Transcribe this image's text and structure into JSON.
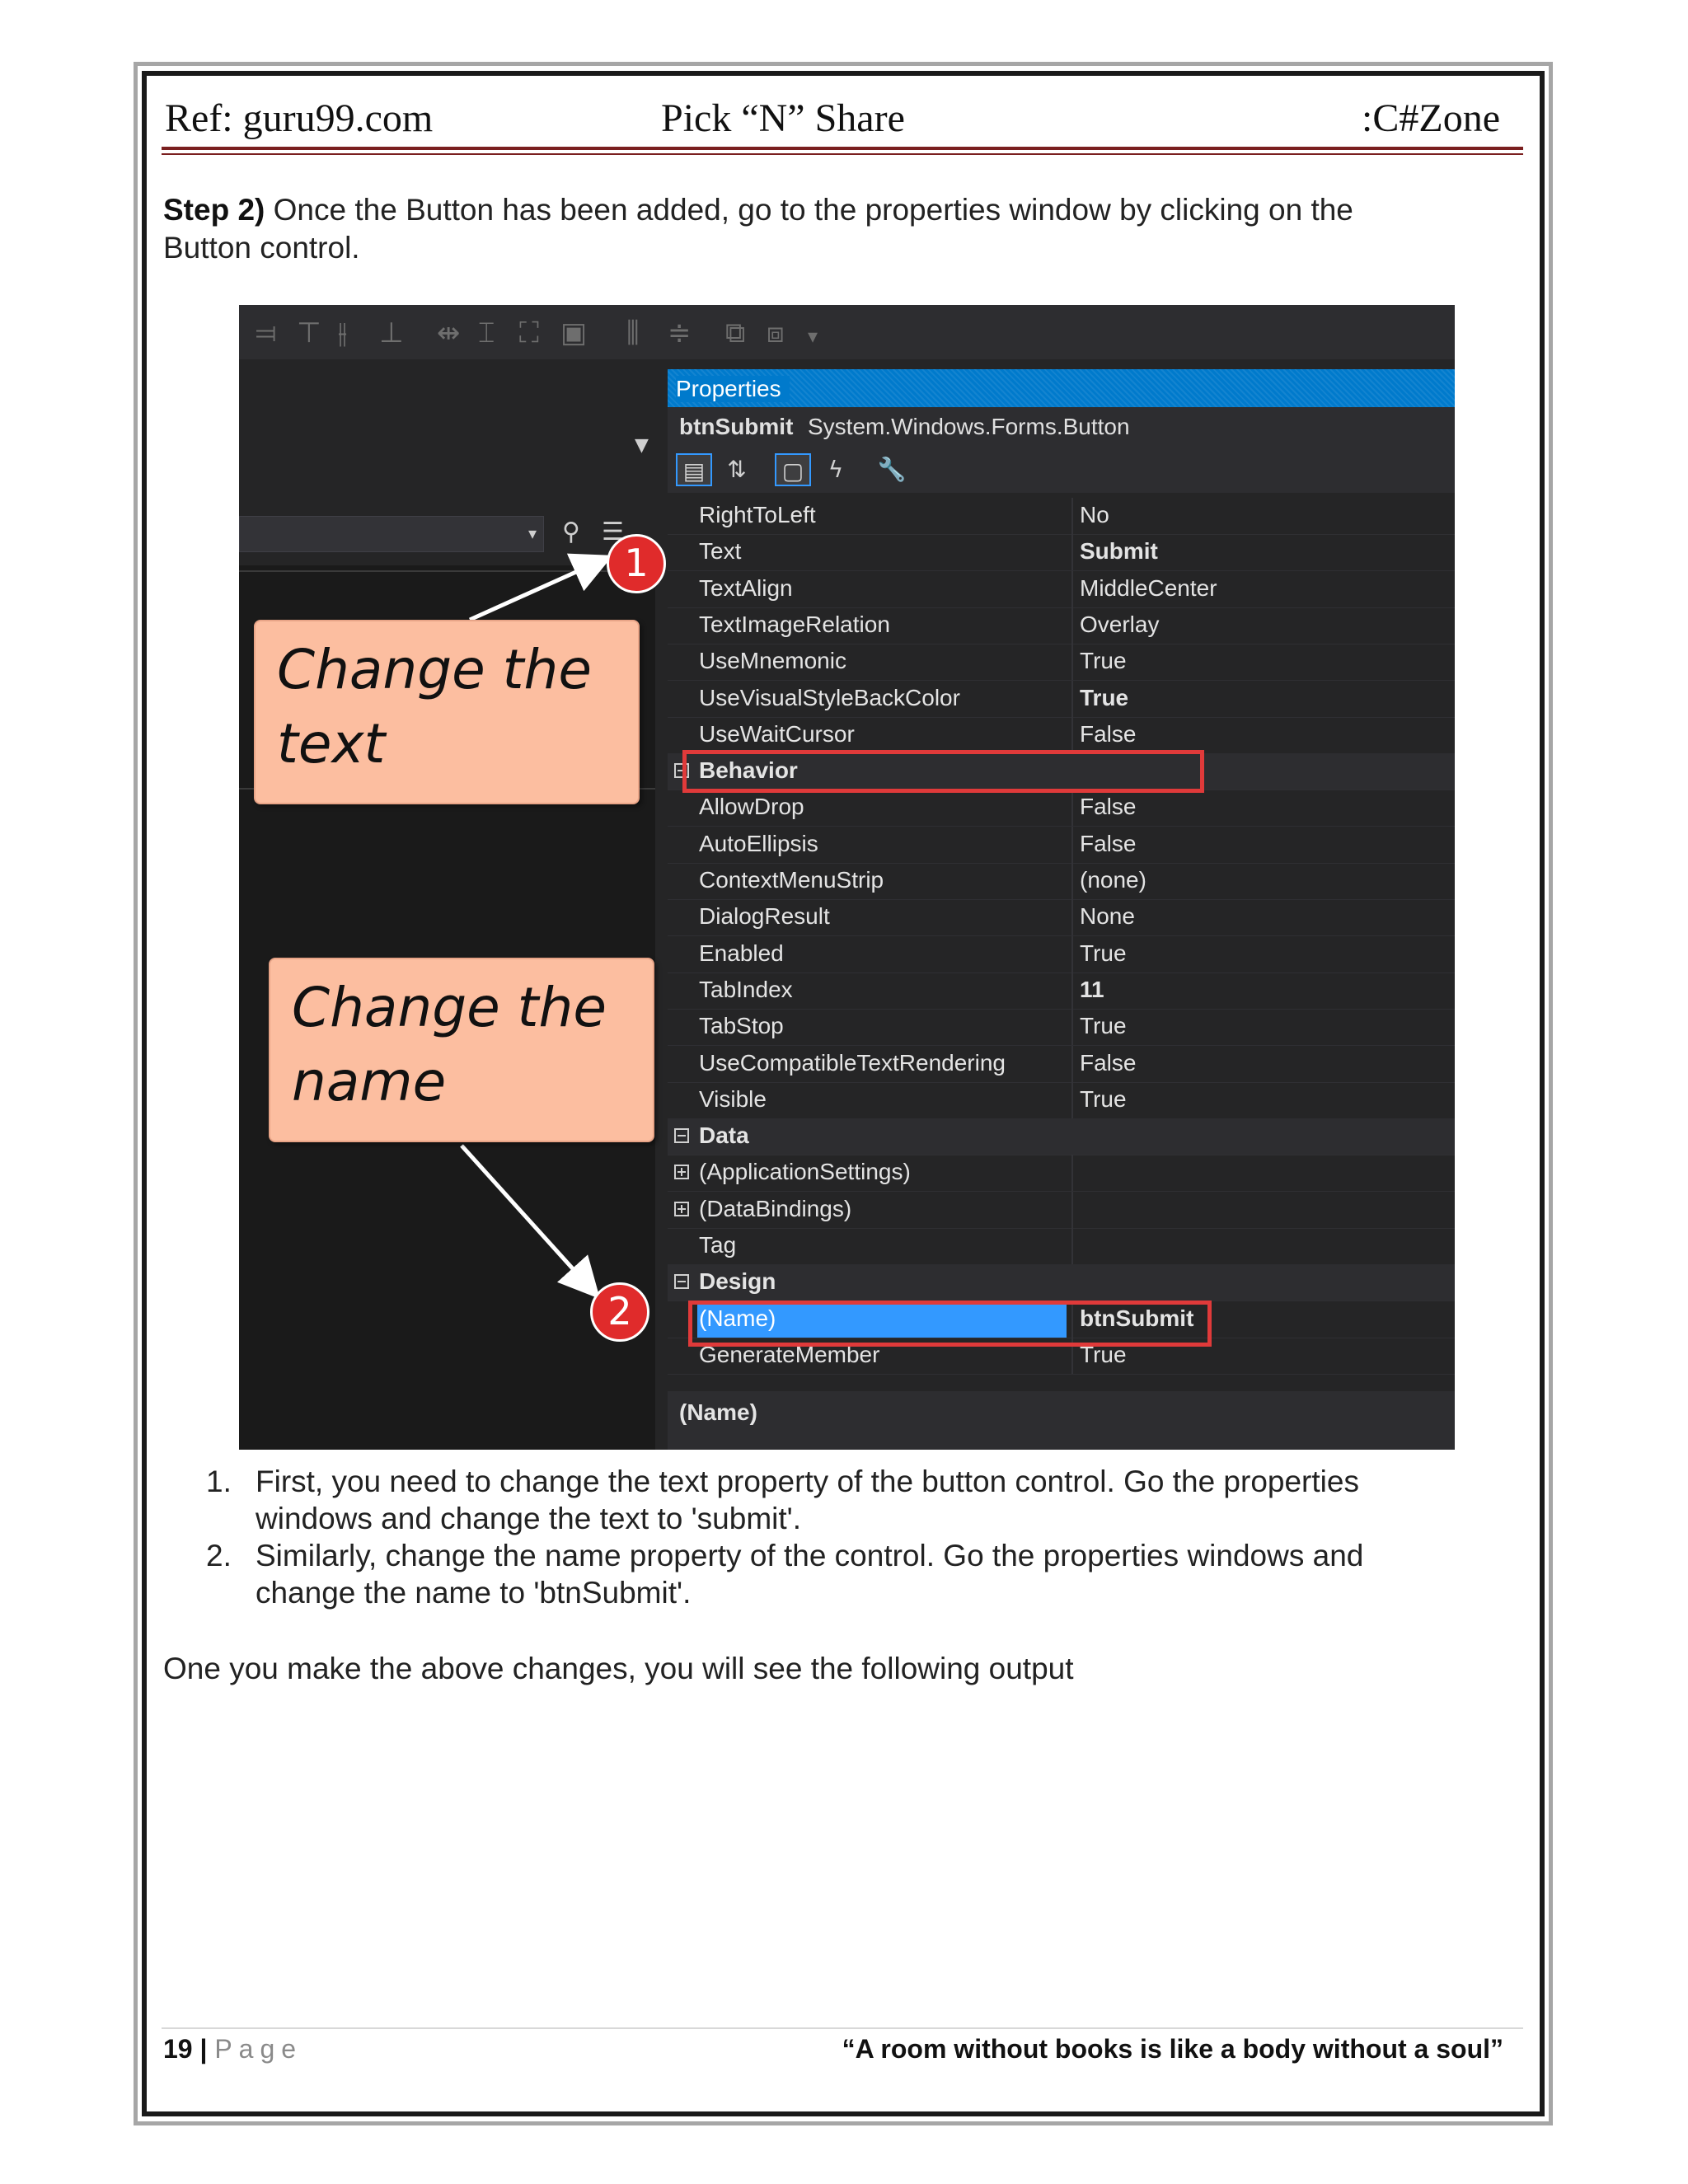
{
  "header": {
    "left": "Ref: guru99.com",
    "center": "Pick “N” Share",
    "right": ":C#Zone"
  },
  "intro": {
    "step_label": "Step 2)",
    "text": " Once the Button has been added, go to the properties window by clicking on the Button control."
  },
  "screenshot": {
    "properties_title": "Properties",
    "object_name": "btnSubmit",
    "object_type": "System.Windows.Forms.Button",
    "rows": [
      {
        "name": "RightToLeft",
        "value": "No"
      },
      {
        "name": "Text",
        "value": "Submit"
      },
      {
        "name": "TextAlign",
        "value": "MiddleCenter"
      },
      {
        "name": "TextImageRelation",
        "value": "Overlay"
      },
      {
        "name": "UseMnemonic",
        "value": "True"
      },
      {
        "name": "UseVisualStyleBackColor",
        "value": "True"
      },
      {
        "name": "UseWaitCursor",
        "value": "False"
      },
      {
        "name": "Behavior",
        "value": ""
      },
      {
        "name": "AllowDrop",
        "value": "False"
      },
      {
        "name": "AutoEllipsis",
        "value": "False"
      },
      {
        "name": "ContextMenuStrip",
        "value": "(none)"
      },
      {
        "name": "DialogResult",
        "value": "None"
      },
      {
        "name": "Enabled",
        "value": "True"
      },
      {
        "name": "TabIndex",
        "value": "11"
      },
      {
        "name": "TabStop",
        "value": "True"
      },
      {
        "name": "UseCompatibleTextRendering",
        "value": "False"
      },
      {
        "name": "Visible",
        "value": "True"
      },
      {
        "name": "Data",
        "value": ""
      },
      {
        "name": "(ApplicationSettings)",
        "value": ""
      },
      {
        "name": "(DataBindings)",
        "value": ""
      },
      {
        "name": "Tag",
        "value": ""
      },
      {
        "name": "Design",
        "value": ""
      },
      {
        "name": "(Name)",
        "value": "btnSubmit"
      },
      {
        "name": "GenerateMember",
        "value": "True"
      }
    ],
    "footer_label": "(Name)",
    "callout_text": [
      "Change the",
      "text"
    ],
    "callout_name": [
      "Change the",
      "name"
    ],
    "badge_1": "1",
    "badge_2": "2",
    "accent_color": "#007acc",
    "highlight_color": "#e03a3a",
    "callout_color": "#fcbea0"
  },
  "steps": [
    {
      "num": "1.",
      "text": "First, you need to change the text property of the button control. Go the properties windows and change the text to 'submit'."
    },
    {
      "num": "2.",
      "text": "Similarly, change the name property of the control. Go the properties windows and change the name to 'btnSubmit'."
    }
  ],
  "outro": "One you make the above changes, you will see the following output",
  "footer": {
    "page_number": "19",
    "separator": "|",
    "page_word": "Page",
    "quote": "“A room without books is like a body without a soul”"
  }
}
